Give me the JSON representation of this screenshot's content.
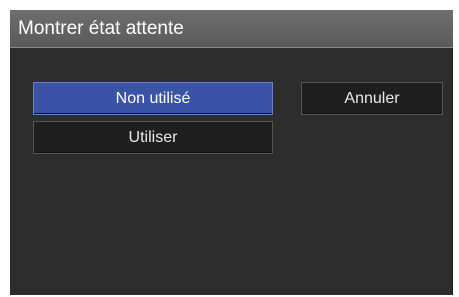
{
  "dialog": {
    "title": "Montrer état attente",
    "options": [
      {
        "label": "Non utilisé",
        "selected": true
      },
      {
        "label": "Utiliser",
        "selected": false
      }
    ],
    "cancel_label": "Annuler"
  },
  "colors": {
    "background": "#2d2d2d",
    "titlebar": "#636363",
    "selected": "#3b53a6",
    "button": "#1f1f1f",
    "text": "#ffffff"
  }
}
